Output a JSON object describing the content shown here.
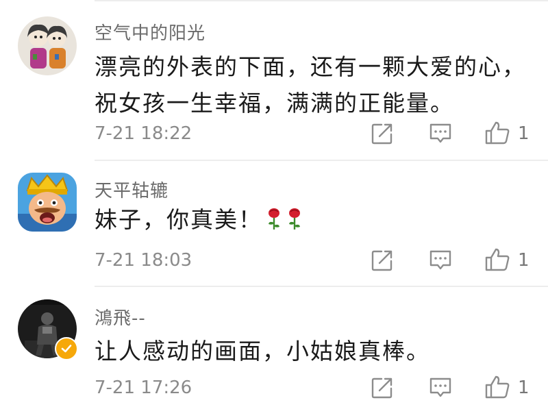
{
  "colors": {
    "username": "#6b6b6b",
    "text": "#1a1a1a",
    "meta": "#8a8a8a",
    "icon": "#8c8c8c",
    "divider": "#ededed",
    "verified": "#f6a80a"
  },
  "comments": [
    {
      "username": "空气中的阳光",
      "text": "漂亮的外表的下面，还有一颗大爱的心，祝女孩一生幸福，满满的正能量。",
      "time": "7-21 18:22",
      "likes": "1",
      "avatar": "cartoon-girls-avatar"
    },
    {
      "username": "天平轱辘",
      "text": "妹子，你真美！",
      "emoji": "rose-icon",
      "time": "7-21 18:03",
      "likes": "1",
      "avatar": "king-cartoon-avatar"
    },
    {
      "username": "鴻飛--",
      "text": "让人感动的画面，小姑娘真棒。",
      "time": "7-21 17:26",
      "likes": "1",
      "avatar": "dark-photo-avatar",
      "verified": true
    }
  ],
  "icons": {
    "share": "share-icon",
    "reply": "comment-icon",
    "like": "thumbs-up-icon"
  }
}
